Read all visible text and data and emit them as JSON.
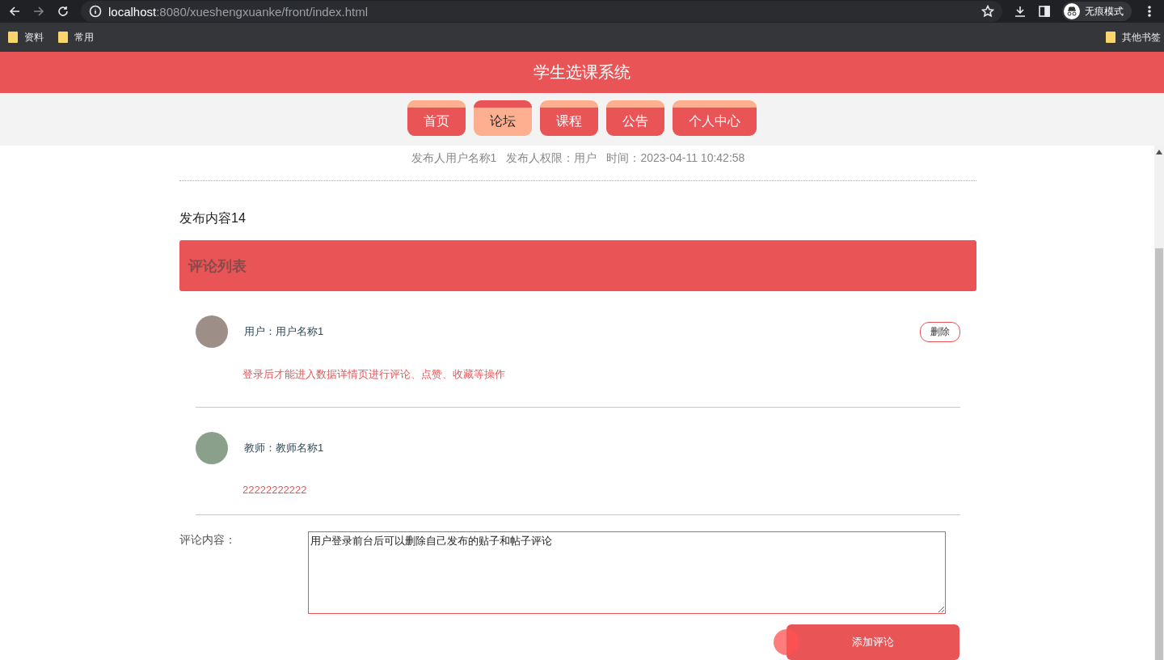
{
  "browser": {
    "url_host": "localhost",
    "url_path": ":8080/xueshengxuanke/front/index.html",
    "profile_label": "无痕模式",
    "bookmarks": [
      "资料",
      "常用"
    ],
    "other_bookmarks": "其他书签"
  },
  "site_title": "学生选课系统",
  "nav": [
    {
      "label": "首页",
      "selected": false
    },
    {
      "label": "论坛",
      "selected": true
    },
    {
      "label": "课程",
      "selected": false
    },
    {
      "label": "公告",
      "selected": false
    },
    {
      "label": "个人中心",
      "selected": false
    }
  ],
  "post": {
    "publisher": "发布人用户名称1",
    "permission": "发布人权限：用户",
    "time": "时间：2023-04-11 10:42:58",
    "content": "发布内容14"
  },
  "comments_title": "评论列表",
  "comments": [
    {
      "author": "用户：用户名称1",
      "text": "登录后才能进入数据详情页进行评论、点赞、收藏等操作",
      "delete_button": "删除"
    },
    {
      "author": "教师：教师名称1",
      "text": "22222222222"
    }
  ],
  "form": {
    "label": "评论内容：",
    "value": "用户登录前台后可以删除自己发布的贴子和帖子评论",
    "submit": "添加评论"
  }
}
